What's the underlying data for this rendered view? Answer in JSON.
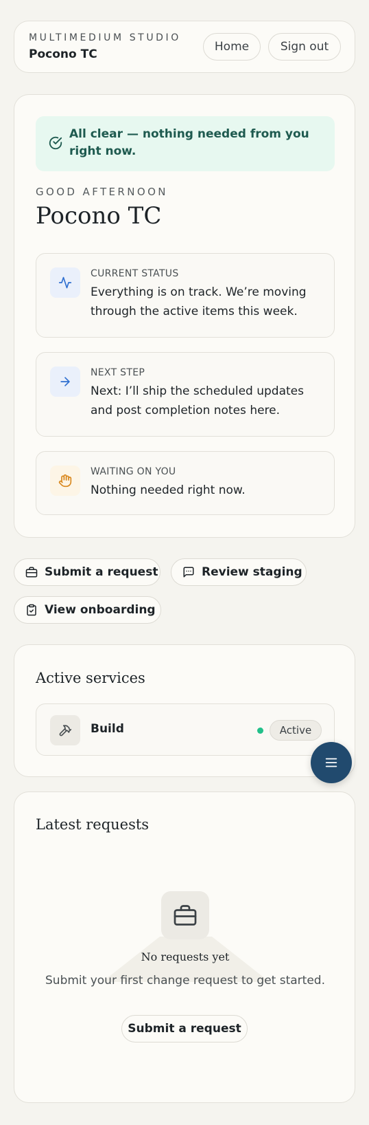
{
  "header": {
    "eyebrow": "MULTIMEDIUM STUDIO",
    "client_name": "Pocono TC",
    "home_label": "Home",
    "signout_label": "Sign out"
  },
  "alert": {
    "text": "All clear — nothing needed from you right now.",
    "icon": "check-circle-icon"
  },
  "greeting": {
    "eyebrow": "GOOD AFTERNOON",
    "title": "Pocono TC"
  },
  "status_cards": [
    {
      "label": "CURRENT STATUS",
      "text": "Everything is on track. We’re moving through the active items this week.",
      "icon": "activity-icon",
      "color": "#2f6fd0"
    },
    {
      "label": "NEXT STEP",
      "text": "Next: I’ll ship the scheduled updates and post completion notes here.",
      "icon": "arrow-right-icon",
      "color": "#2f6fd0"
    },
    {
      "label": "WAITING ON YOU",
      "text": "Nothing needed right now.",
      "icon": "hand-icon",
      "color": "#d9871c"
    }
  ],
  "actions": {
    "submit_label": "Submit a request",
    "review_label": "Review staging",
    "onboarding_label": "View onboarding"
  },
  "services": {
    "title": "Active services",
    "items": [
      {
        "name": "Build",
        "status": "Active",
        "icon": "hammer-icon",
        "status_color": "#22c08a"
      }
    ]
  },
  "requests": {
    "title": "Latest requests",
    "empty_title": "No requests yet",
    "empty_subtitle": "Submit your first change request to get started.",
    "empty_button": "Submit a request",
    "icon": "briefcase-icon"
  },
  "fab": {
    "icon": "menu-icon",
    "color": "#214a6e"
  },
  "colors": {
    "background": "#f5f4ef",
    "card": "#fcfbf7",
    "alert_bg": "#e7f8f0",
    "alert_text": "#1e5a4f"
  }
}
